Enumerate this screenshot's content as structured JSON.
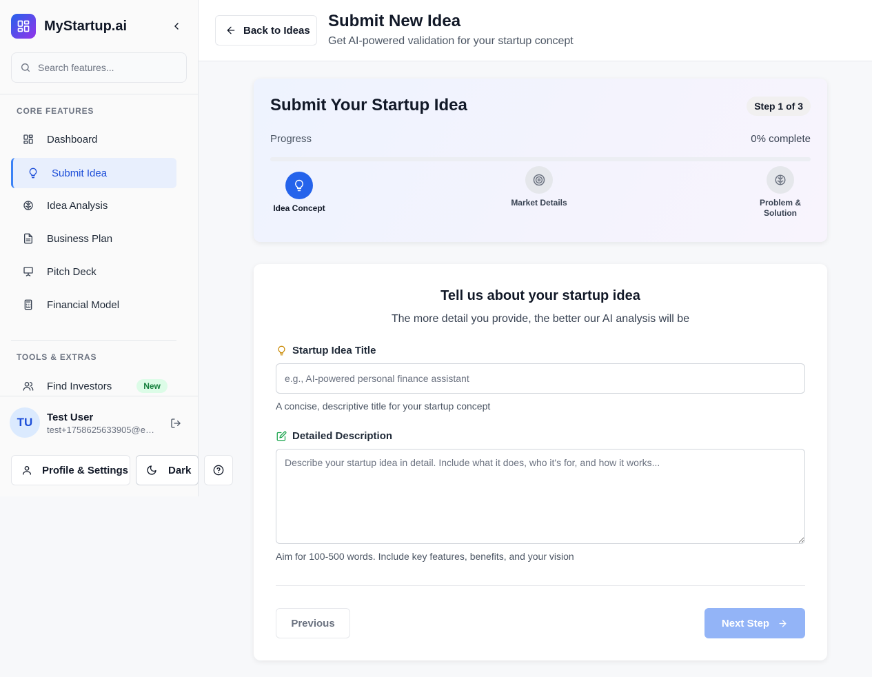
{
  "app": {
    "name": "MyStartup.ai"
  },
  "sidebar": {
    "search_placeholder": "Search features...",
    "core_label": "CORE FEATURES",
    "core_items": [
      {
        "label": "Dashboard",
        "icon": "dashboard-icon"
      },
      {
        "label": "Submit Idea",
        "icon": "lightbulb-icon",
        "active": true
      },
      {
        "label": "Idea Analysis",
        "icon": "brain-icon"
      },
      {
        "label": "Business Plan",
        "icon": "document-icon"
      },
      {
        "label": "Pitch Deck",
        "icon": "presentation-icon"
      },
      {
        "label": "Financial Model",
        "icon": "calculator-icon"
      }
    ],
    "tools_label": "TOOLS & EXTRAS",
    "tools_items": [
      {
        "label": "Find Investors",
        "icon": "users-icon",
        "badge": "New"
      }
    ]
  },
  "user": {
    "initials": "TU",
    "name": "Test User",
    "email": "test+1758625633905@ex..."
  },
  "footer_buttons": {
    "profile": "Profile & Settings",
    "theme": "Dark"
  },
  "header": {
    "back_label": "Back to Ideas",
    "title": "Submit New Idea",
    "subtitle": "Get AI-powered validation for your startup concept"
  },
  "progress_card": {
    "title": "Submit Your Startup Idea",
    "step_indicator": "Step 1 of 3",
    "progress_label": "Progress",
    "progress_text": "0% complete",
    "progress_fraction": 0,
    "steps": [
      {
        "label": "Idea Concept",
        "icon": "lightbulb-icon",
        "active": true
      },
      {
        "label": "Market Details",
        "icon": "target-icon",
        "active": false
      },
      {
        "label": "Problem & Solution",
        "icon": "brain-icon",
        "active": false
      }
    ]
  },
  "form": {
    "title": "Tell us about your startup idea",
    "subtitle": "The more detail you provide, the better our AI analysis will be",
    "title_field": {
      "label": "Startup Idea Title",
      "placeholder": "e.g., AI-powered personal finance assistant",
      "value": "",
      "help": "A concise, descriptive title for your startup concept"
    },
    "description_field": {
      "label": "Detailed Description",
      "placeholder": "Describe your startup idea in detail. Include what it does, who it's for, and how it works...",
      "value": "",
      "help": "Aim for 100-500 words. Include key features, benefits, and your vision"
    },
    "prev_label": "Previous",
    "next_label": "Next Step"
  },
  "colors": {
    "accent": "#2563eb",
    "active_nav_bg": "#e8effd",
    "next_disabled": "#93b4f7",
    "badge_green": "#15803d"
  }
}
